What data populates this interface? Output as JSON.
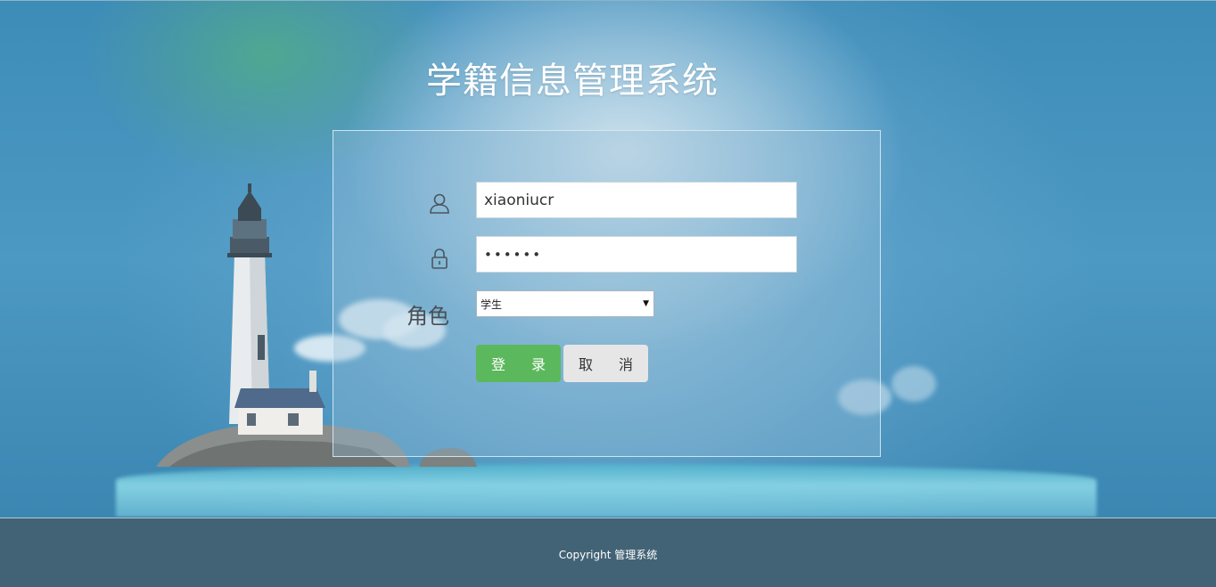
{
  "page": {
    "title": "学籍信息管理系统"
  },
  "login": {
    "username_value": "xiaoniucr",
    "password_value": "••••••",
    "role_label": "角色",
    "role_selected": "学生",
    "login_label": "登 录",
    "cancel_label": "取 消"
  },
  "icons": {
    "user": "user-icon",
    "lock": "lock-icon",
    "dropdown": "chevron-down-icon"
  },
  "footer": {
    "copyright": "Copyright 管理系统"
  },
  "colors": {
    "login_button": "#5cb85c",
    "cancel_button": "#e6e6e6",
    "footer_bg": "#426375",
    "background": "#3b86b0"
  }
}
